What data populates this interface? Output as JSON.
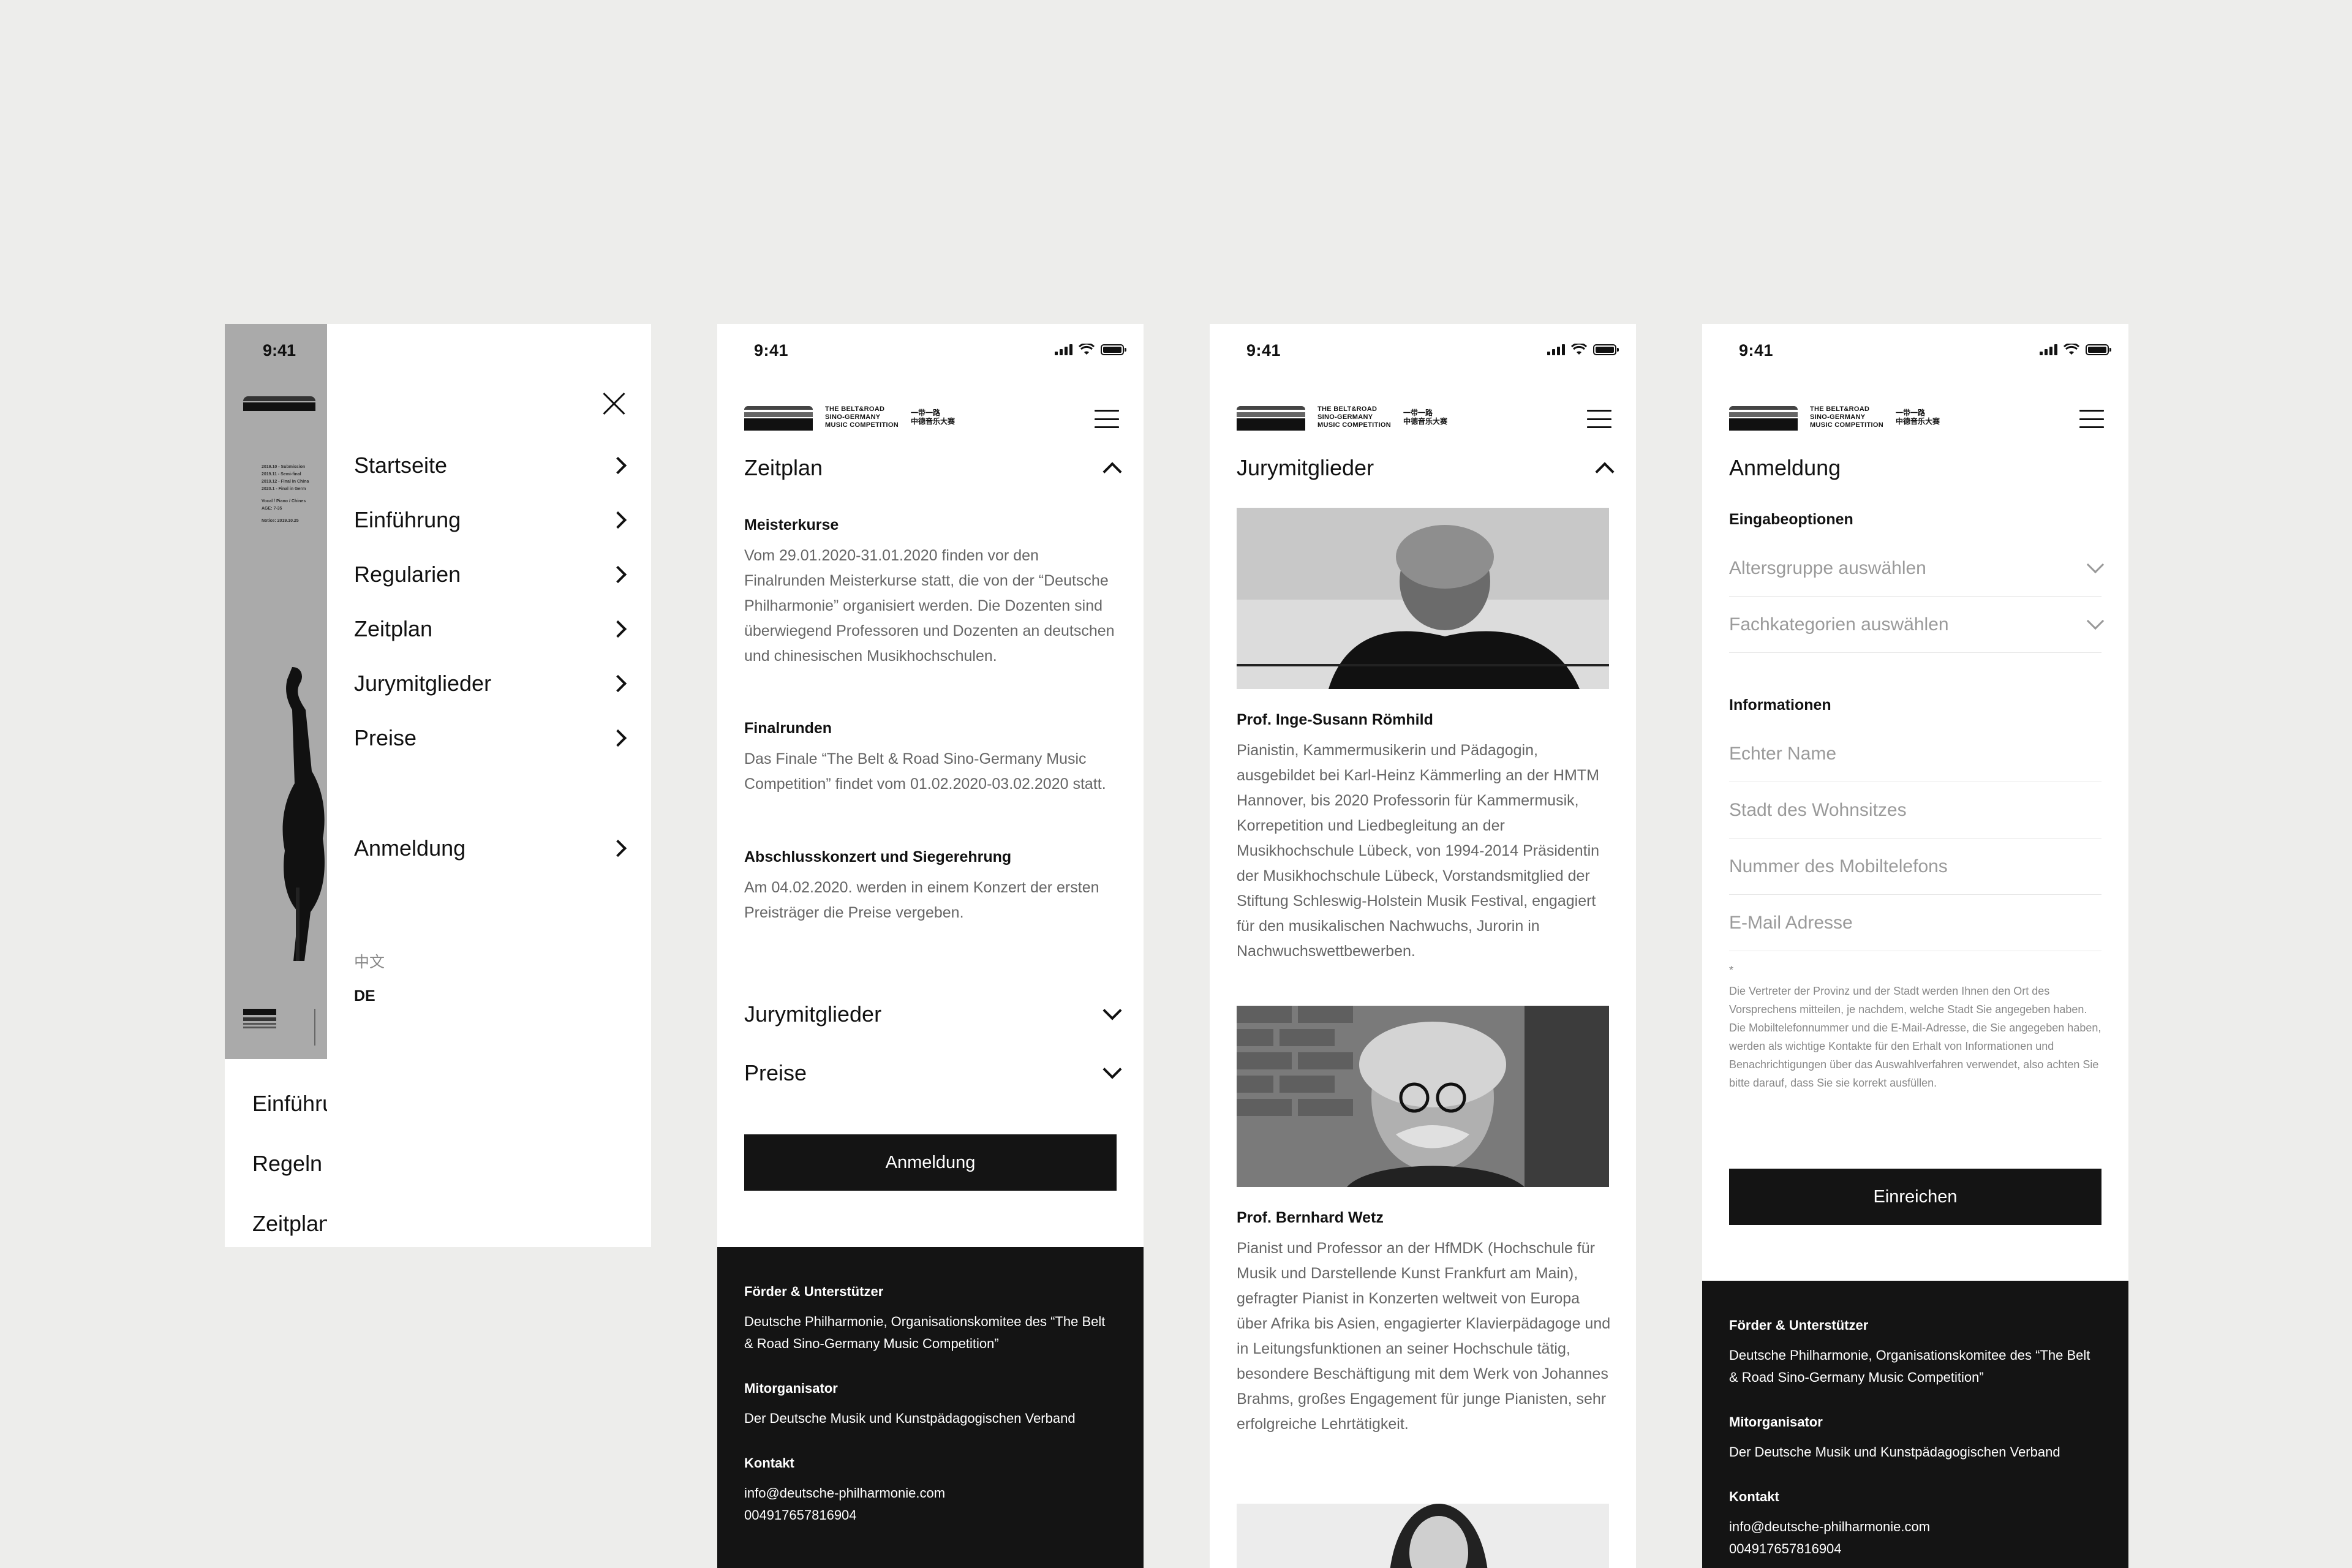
{
  "status": {
    "time": "9:41"
  },
  "logo": {
    "line1": "THE BELT&ROAD",
    "line2": "SINO-GERMANY",
    "line3": "MUSIC COMPETITION",
    "cn1": "一带一路",
    "cn2": "中德音乐大赛"
  },
  "screen1": {
    "menu": [
      "Startseite",
      "Einführung",
      "Regularien",
      "Zeitplan",
      "Jurymitglieder",
      "Preise"
    ],
    "register": "Anmeldung",
    "lang_cn": "中文",
    "lang_de": "DE",
    "behind": [
      "Einführu",
      "Regeln",
      "Zeitplan"
    ],
    "poster_lines": [
      "2019.10 - Submission",
      "2019.11 - Semi-final",
      "2019.12 - Final in China",
      "2020.1 - Final in Germ",
      "Vocal / Piano / Chines",
      "AGE: 7-35",
      "Notice: 2019.10.25"
    ]
  },
  "screen2": {
    "section": "Zeitplan",
    "items": [
      {
        "title": "Meisterkurse",
        "text": "Vom 29.01.2020-31.01.2020 finden vor den Finalrunden Meisterkurse statt, die von der “Deutsche Philharmonie” organisiert werden. Die Dozenten sind überwiegend Professoren und Dozenten an deutschen und chinesischen Musikhochschulen."
      },
      {
        "title": "Finalrunden",
        "text": "Das Finale “The Belt & Road Sino-Germany Music Competition” findet vom 01.02.2020-03.02.2020 statt."
      },
      {
        "title": "Abschlusskonzert und Siegerehrung",
        "text": "Am 04.02.2020. werden in einem Konzert der ersten Preisträger die Preise vergeben."
      }
    ],
    "collapsed": [
      "Jurymitglieder",
      "Preise"
    ],
    "button": "Anmeldung"
  },
  "footer": {
    "h1": "Förder & Unterstützer",
    "t1": "Deutsche Philharmonie, Organisationskomitee des “The Belt & Road Sino-Germany Music Competition”",
    "h2": "Mitorganisator",
    "t2": "Der Deutsche Musik und Kunstpädagogischen Verband",
    "h3": "Kontakt",
    "email": "info@deutsche-philharmonie.com",
    "phone": "004917657816904"
  },
  "screen3": {
    "section": "Jurymitglieder",
    "members": [
      {
        "name": "Prof. Inge-Susann Römhild",
        "bio": "Pianistin, Kammermusikerin und Pädagogin, ausgebildet bei Karl-Heinz Kämmerling an der HMTM Hannover, bis 2020 Professorin für Kammermusik, Korrepetition und Liedbegleitung an der Musikhochschule Lübeck, von 1994-2014 Präsidentin der Musikhochschule Lübeck, Vorstandsmitglied der Stiftung Schleswig-Holstein Musik Festival, engagiert für den musikalischen Nachwuchs, Jurorin in Nachwuchswettbewerben."
      },
      {
        "name": "Prof. Bernhard Wetz",
        "bio": "Pianist und Professor an der HfMDK (Hochschule für Musik und Darstellende Kunst Frankfurt am Main), gefragter Pianist in Konzerten weltweit von Europa über Afrika bis Asien, engagierter Klavierpädagoge und in Leitungsfunktionen an seiner Hochschule tätig, besondere Beschäftigung mit dem Werk von Johannes Brahms, großes Engagement für junge Pianisten, sehr erfolgreiche Lehrtätigkeit."
      }
    ]
  },
  "screen4": {
    "section": "Anmeldung",
    "options_title": "Eingabeoptionen",
    "select1": "Altersgruppe auswählen",
    "select2": "Fachkategorien auswählen",
    "info_title": "Informationen",
    "fields": [
      "Echter Name",
      "Stadt des Wohnsitzes",
      "Nummer des Mobiltelefons",
      "E-Mail Adresse"
    ],
    "asterisk": "*",
    "note": "Die Vertreter der Provinz und der Stadt werden Ihnen den Ort des Vorsprechens mitteilen, je nachdem, welche Stadt Sie angegeben haben. Die Mobiltelefonnummer und die E-Mail-Adresse, die Sie angegeben haben, werden als wichtige Kontakte für den Erhalt von Informationen und Benachrichtigungen über das Auswahlverfahren verwendet, also achten Sie bitte darauf, dass Sie sie korrekt ausfüllen.",
    "submit": "Einreichen"
  }
}
